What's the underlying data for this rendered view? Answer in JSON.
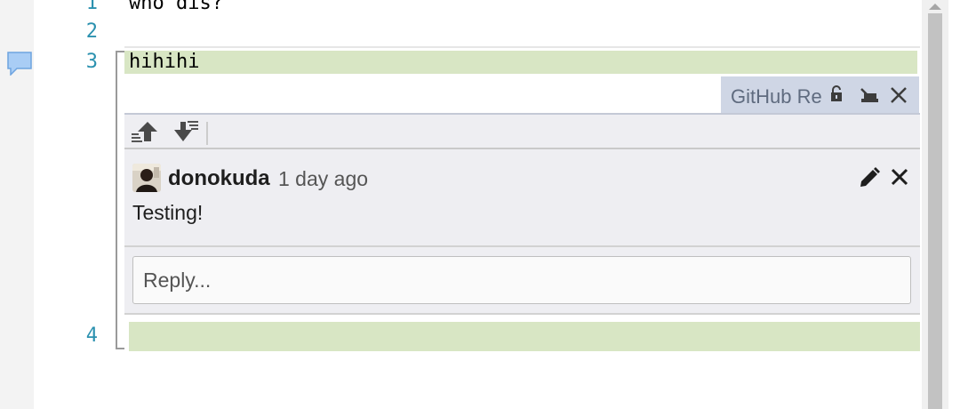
{
  "editor": {
    "lines": [
      {
        "number": "1",
        "text": "who dis?"
      },
      {
        "number": "2",
        "text": ""
      },
      {
        "number": "3",
        "text": "hihihi"
      },
      {
        "number": "4",
        "text": ""
      }
    ],
    "added_line_color": "#d8e6c4",
    "line_number_color": "#2b91af"
  },
  "peek": {
    "tab_title": "GitHub Review",
    "tab_background": "#cfd6e5",
    "toolbar": {
      "prev_icon": "previous-comment-icon",
      "next_icon": "next-comment-icon"
    }
  },
  "comment": {
    "author": "donokuda",
    "time": "1 day ago",
    "body": "Testing!",
    "avatar_icon": "user-avatar",
    "edit_icon": "pencil-icon",
    "delete_icon": "close-icon"
  },
  "reply": {
    "placeholder": "Reply..."
  }
}
